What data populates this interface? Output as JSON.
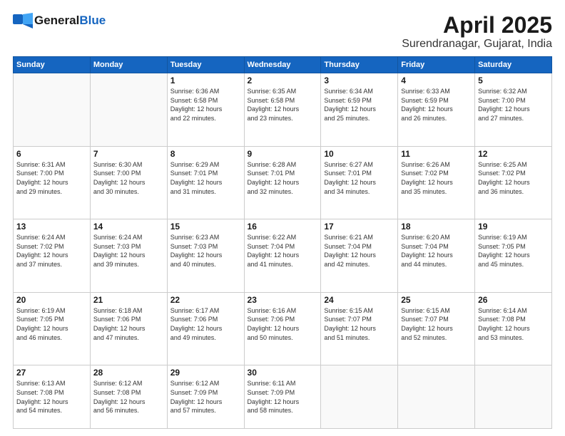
{
  "header": {
    "logo_general": "General",
    "logo_blue": "Blue",
    "title": "April 2025",
    "subtitle": "Surendranagar, Gujarat, India"
  },
  "calendar": {
    "days_of_week": [
      "Sunday",
      "Monday",
      "Tuesday",
      "Wednesday",
      "Thursday",
      "Friday",
      "Saturday"
    ],
    "weeks": [
      [
        {
          "day": "",
          "info": ""
        },
        {
          "day": "",
          "info": ""
        },
        {
          "day": "1",
          "info": "Sunrise: 6:36 AM\nSunset: 6:58 PM\nDaylight: 12 hours\nand 22 minutes."
        },
        {
          "day": "2",
          "info": "Sunrise: 6:35 AM\nSunset: 6:58 PM\nDaylight: 12 hours\nand 23 minutes."
        },
        {
          "day": "3",
          "info": "Sunrise: 6:34 AM\nSunset: 6:59 PM\nDaylight: 12 hours\nand 25 minutes."
        },
        {
          "day": "4",
          "info": "Sunrise: 6:33 AM\nSunset: 6:59 PM\nDaylight: 12 hours\nand 26 minutes."
        },
        {
          "day": "5",
          "info": "Sunrise: 6:32 AM\nSunset: 7:00 PM\nDaylight: 12 hours\nand 27 minutes."
        }
      ],
      [
        {
          "day": "6",
          "info": "Sunrise: 6:31 AM\nSunset: 7:00 PM\nDaylight: 12 hours\nand 29 minutes."
        },
        {
          "day": "7",
          "info": "Sunrise: 6:30 AM\nSunset: 7:00 PM\nDaylight: 12 hours\nand 30 minutes."
        },
        {
          "day": "8",
          "info": "Sunrise: 6:29 AM\nSunset: 7:01 PM\nDaylight: 12 hours\nand 31 minutes."
        },
        {
          "day": "9",
          "info": "Sunrise: 6:28 AM\nSunset: 7:01 PM\nDaylight: 12 hours\nand 32 minutes."
        },
        {
          "day": "10",
          "info": "Sunrise: 6:27 AM\nSunset: 7:01 PM\nDaylight: 12 hours\nand 34 minutes."
        },
        {
          "day": "11",
          "info": "Sunrise: 6:26 AM\nSunset: 7:02 PM\nDaylight: 12 hours\nand 35 minutes."
        },
        {
          "day": "12",
          "info": "Sunrise: 6:25 AM\nSunset: 7:02 PM\nDaylight: 12 hours\nand 36 minutes."
        }
      ],
      [
        {
          "day": "13",
          "info": "Sunrise: 6:24 AM\nSunset: 7:02 PM\nDaylight: 12 hours\nand 37 minutes."
        },
        {
          "day": "14",
          "info": "Sunrise: 6:24 AM\nSunset: 7:03 PM\nDaylight: 12 hours\nand 39 minutes."
        },
        {
          "day": "15",
          "info": "Sunrise: 6:23 AM\nSunset: 7:03 PM\nDaylight: 12 hours\nand 40 minutes."
        },
        {
          "day": "16",
          "info": "Sunrise: 6:22 AM\nSunset: 7:04 PM\nDaylight: 12 hours\nand 41 minutes."
        },
        {
          "day": "17",
          "info": "Sunrise: 6:21 AM\nSunset: 7:04 PM\nDaylight: 12 hours\nand 42 minutes."
        },
        {
          "day": "18",
          "info": "Sunrise: 6:20 AM\nSunset: 7:04 PM\nDaylight: 12 hours\nand 44 minutes."
        },
        {
          "day": "19",
          "info": "Sunrise: 6:19 AM\nSunset: 7:05 PM\nDaylight: 12 hours\nand 45 minutes."
        }
      ],
      [
        {
          "day": "20",
          "info": "Sunrise: 6:19 AM\nSunset: 7:05 PM\nDaylight: 12 hours\nand 46 minutes."
        },
        {
          "day": "21",
          "info": "Sunrise: 6:18 AM\nSunset: 7:06 PM\nDaylight: 12 hours\nand 47 minutes."
        },
        {
          "day": "22",
          "info": "Sunrise: 6:17 AM\nSunset: 7:06 PM\nDaylight: 12 hours\nand 49 minutes."
        },
        {
          "day": "23",
          "info": "Sunrise: 6:16 AM\nSunset: 7:06 PM\nDaylight: 12 hours\nand 50 minutes."
        },
        {
          "day": "24",
          "info": "Sunrise: 6:15 AM\nSunset: 7:07 PM\nDaylight: 12 hours\nand 51 minutes."
        },
        {
          "day": "25",
          "info": "Sunrise: 6:15 AM\nSunset: 7:07 PM\nDaylight: 12 hours\nand 52 minutes."
        },
        {
          "day": "26",
          "info": "Sunrise: 6:14 AM\nSunset: 7:08 PM\nDaylight: 12 hours\nand 53 minutes."
        }
      ],
      [
        {
          "day": "27",
          "info": "Sunrise: 6:13 AM\nSunset: 7:08 PM\nDaylight: 12 hours\nand 54 minutes."
        },
        {
          "day": "28",
          "info": "Sunrise: 6:12 AM\nSunset: 7:08 PM\nDaylight: 12 hours\nand 56 minutes."
        },
        {
          "day": "29",
          "info": "Sunrise: 6:12 AM\nSunset: 7:09 PM\nDaylight: 12 hours\nand 57 minutes."
        },
        {
          "day": "30",
          "info": "Sunrise: 6:11 AM\nSunset: 7:09 PM\nDaylight: 12 hours\nand 58 minutes."
        },
        {
          "day": "",
          "info": ""
        },
        {
          "day": "",
          "info": ""
        },
        {
          "day": "",
          "info": ""
        }
      ]
    ]
  }
}
